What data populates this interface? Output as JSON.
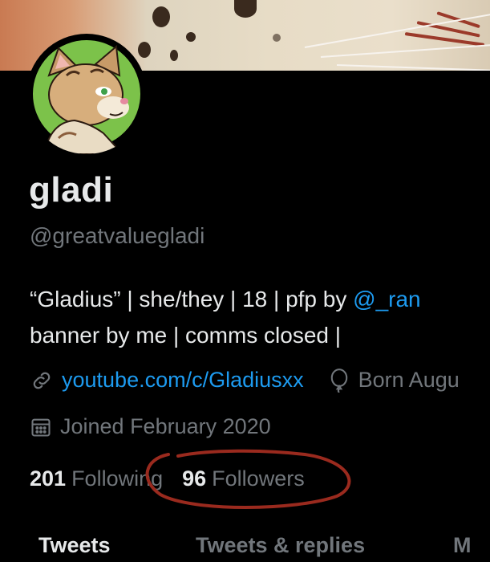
{
  "profile": {
    "display_name": "gladi",
    "handle": "@greatvaluegladi",
    "bio": {
      "line1_text": "“Gladius” | she/they | 18 | pfp by ",
      "line1_mention": "@_ran",
      "line2_text": "banner by me | comms closed |"
    },
    "link": "youtube.com/c/Gladiusxx",
    "birthday": "Born Augu",
    "joined": "Joined February 2020",
    "following_count": "201",
    "following_label": "Following",
    "followers_count": "96",
    "followers_label": "Followers"
  },
  "tabs": [
    {
      "label": "Tweets"
    },
    {
      "label": "Tweets & replies"
    },
    {
      "label": "M"
    }
  ],
  "colors": {
    "background": "#000000",
    "text_primary": "#e7e9ea",
    "text_secondary": "#71767b",
    "link": "#1d9bf0",
    "annotation_circle": "#9a2a1e",
    "avatar_ring": "#7cc24a"
  },
  "icons": {
    "link": "link-icon",
    "birthday": "balloon-icon",
    "joined": "calendar-icon"
  }
}
